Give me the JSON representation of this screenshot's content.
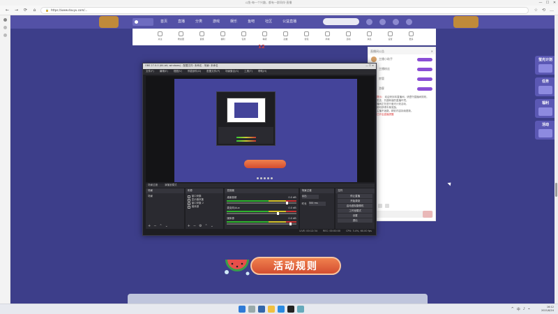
{
  "browser": {
    "window_title": "斗鱼-每一个兴趣，都有一群同伴-直播",
    "url": "https://www.douyu.com/...",
    "back": "←",
    "forward": "→",
    "reload": "⟳",
    "home": "⌂",
    "window_controls": [
      "—",
      "☐",
      "✕"
    ],
    "toolbar_icons": [
      "☆",
      "⟲",
      "…"
    ]
  },
  "site": {
    "nav": [
      "首页",
      "直播",
      "分类",
      "游戏",
      "娱乐",
      "鱼吧",
      "社区",
      "公益直播"
    ],
    "live_date": "12",
    "subnav_items": [
      "关注",
      "粉丝团",
      "贵族",
      "福利",
      "任务",
      "等级",
      "勋章",
      "钱包",
      "商城",
      "活动",
      "消息",
      "设置",
      "更多"
    ],
    "activity_rules": "活动规则",
    "side_ads": [
      "萤光计划",
      "任务",
      "福利",
      "活动"
    ]
  },
  "chat_panel": {
    "header": "直播间公告",
    "users": [
      "主播小助手",
      "主播粉丝",
      "房管",
      "游客"
    ],
    "text_lines": [
      "欢迎来到本直播间，请遵守直播间规则，",
      "文明发言，共建和谐的直播环境。",
      "本直播间正在进行萤光计划活动，",
      "参与即可获得丰厚奖励。",
      "关注主播不迷路，精彩内容持续更新。"
    ],
    "highlight": "系统提示：",
    "follow_note": "主播已开启直播提醒"
  },
  "obs": {
    "title": "OBS 27.0.0 (64-bit, windows) - 配置文件: 未命名 - 场景: 未命名",
    "menu": [
      "文件(F)",
      "编辑(E)",
      "视图(V)",
      "停靠部件(D)",
      "配置文件(P)",
      "场景集合(S)",
      "工具(T)",
      "帮助(H)"
    ],
    "mode_bar": [
      "场景过渡",
      "演播室模式"
    ],
    "docks": {
      "scenes": {
        "title": "场景",
        "items": [
          "场景"
        ]
      },
      "sources": {
        "title": "来源",
        "items": [
          "窗口采集",
          "显示器采集",
          "窗口采集 2",
          "媒体源"
        ]
      },
      "mixer": {
        "title": "混音器",
        "channels": [
          {
            "name": "桌面音频",
            "db": "0.0 dB",
            "level": 0.85
          },
          {
            "name": "麦克风/Aux",
            "db": "0.0 dB",
            "level": 0.72
          },
          {
            "name": "媒体源",
            "db": "0.0 dB",
            "level": 0.9
          }
        ]
      },
      "transitions": {
        "title": "场景过渡",
        "type": "淡出",
        "duration_label": "时长",
        "duration": "300 ms"
      },
      "controls": {
        "title": "控件",
        "buttons": [
          "停止直播",
          "开始录制",
          "启动虚拟摄像机",
          "工作室模式",
          "设置",
          "退出"
        ]
      }
    },
    "status": [
      "LIVE: 00:12:34",
      "REC: 00:00:00",
      "CPU: 3.4%, 60.00 fps"
    ]
  },
  "taskbar": {
    "time": "16:12",
    "date": "2021/6/24",
    "tray": [
      "^",
      "中",
      "♪",
      "⌁"
    ]
  },
  "colors": {
    "page_bg": "#3d3e8a",
    "header_bg": "#5351a6",
    "rules_button": "#e06540",
    "obs_bg": "#1e1e22"
  }
}
